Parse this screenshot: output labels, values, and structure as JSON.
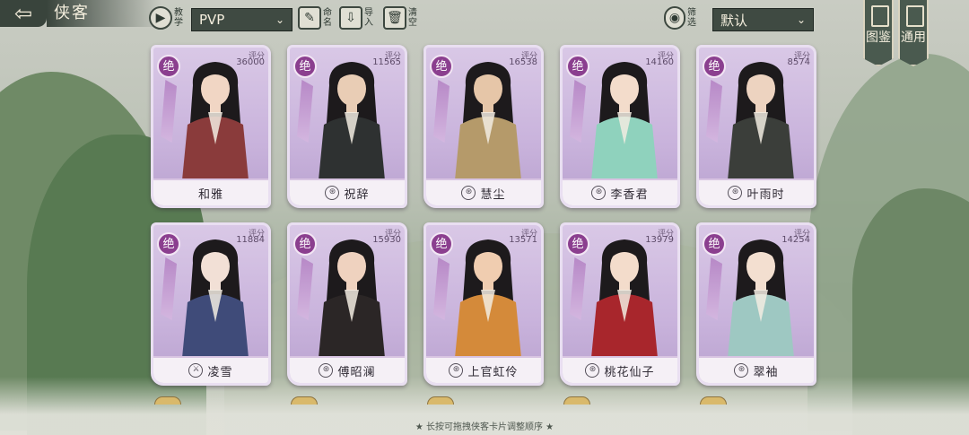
{
  "header": {
    "back_icon": "arrow-left-icon",
    "title": "侠客",
    "tutorial_label": "教学",
    "mode_select": "PVP",
    "rename_label": "命名",
    "import_label": "导入",
    "clear_label": "清空",
    "filter_label": "筛选",
    "sort_select": "默认",
    "codex_label": "图鉴",
    "general_label": "通用"
  },
  "cards": [
    {
      "rarity": "绝",
      "score_label": "评分",
      "score": "36000",
      "name": "和雅",
      "faction": "",
      "robe": "#8a3b3b",
      "skin": "#f1d6c4"
    },
    {
      "rarity": "绝",
      "score_label": "评分",
      "score": "11565",
      "name": "祝辞",
      "faction": "⊛",
      "robe": "#2e3131",
      "skin": "#e9cdb5"
    },
    {
      "rarity": "绝",
      "score_label": "评分",
      "score": "16538",
      "name": "慧尘",
      "faction": "⊛",
      "robe": "#b59a6a",
      "skin": "#e6c6a8"
    },
    {
      "rarity": "绝",
      "score_label": "评分",
      "score": "14160",
      "name": "李香君",
      "faction": "⊛",
      "robe": "#8fd2bd",
      "skin": "#f3dccb"
    },
    {
      "rarity": "绝",
      "score_label": "评分",
      "score": "8574",
      "name": "叶雨时",
      "faction": "⊛",
      "robe": "#3b3e3a",
      "skin": "#edd3c0"
    },
    {
      "rarity": "绝",
      "score_label": "评分",
      "score": "11884",
      "name": "凌雪",
      "faction": "⚔",
      "robe": "#3f4b79",
      "skin": "#f2e0d6"
    },
    {
      "rarity": "绝",
      "score_label": "评分",
      "score": "15930",
      "name": "傅昭澜",
      "faction": "⊛",
      "robe": "#2b2626",
      "skin": "#efd2bf"
    },
    {
      "rarity": "绝",
      "score_label": "评分",
      "score": "13571",
      "name": "上官虹伶",
      "faction": "⊛",
      "robe": "#d48a3a",
      "skin": "#f0cdb0"
    },
    {
      "rarity": "绝",
      "score_label": "评分",
      "score": "13979",
      "name": "桃花仙子",
      "faction": "⊛",
      "robe": "#a8262c",
      "skin": "#f3dccb"
    },
    {
      "rarity": "绝",
      "score_label": "评分",
      "score": "14254",
      "name": "翠袖",
      "faction": "⊛",
      "robe": "#9ec8c2",
      "skin": "#f3dfd0"
    }
  ],
  "footer": {
    "hint": "★ 长按可拖拽侠客卡片调整顺序 ★"
  }
}
